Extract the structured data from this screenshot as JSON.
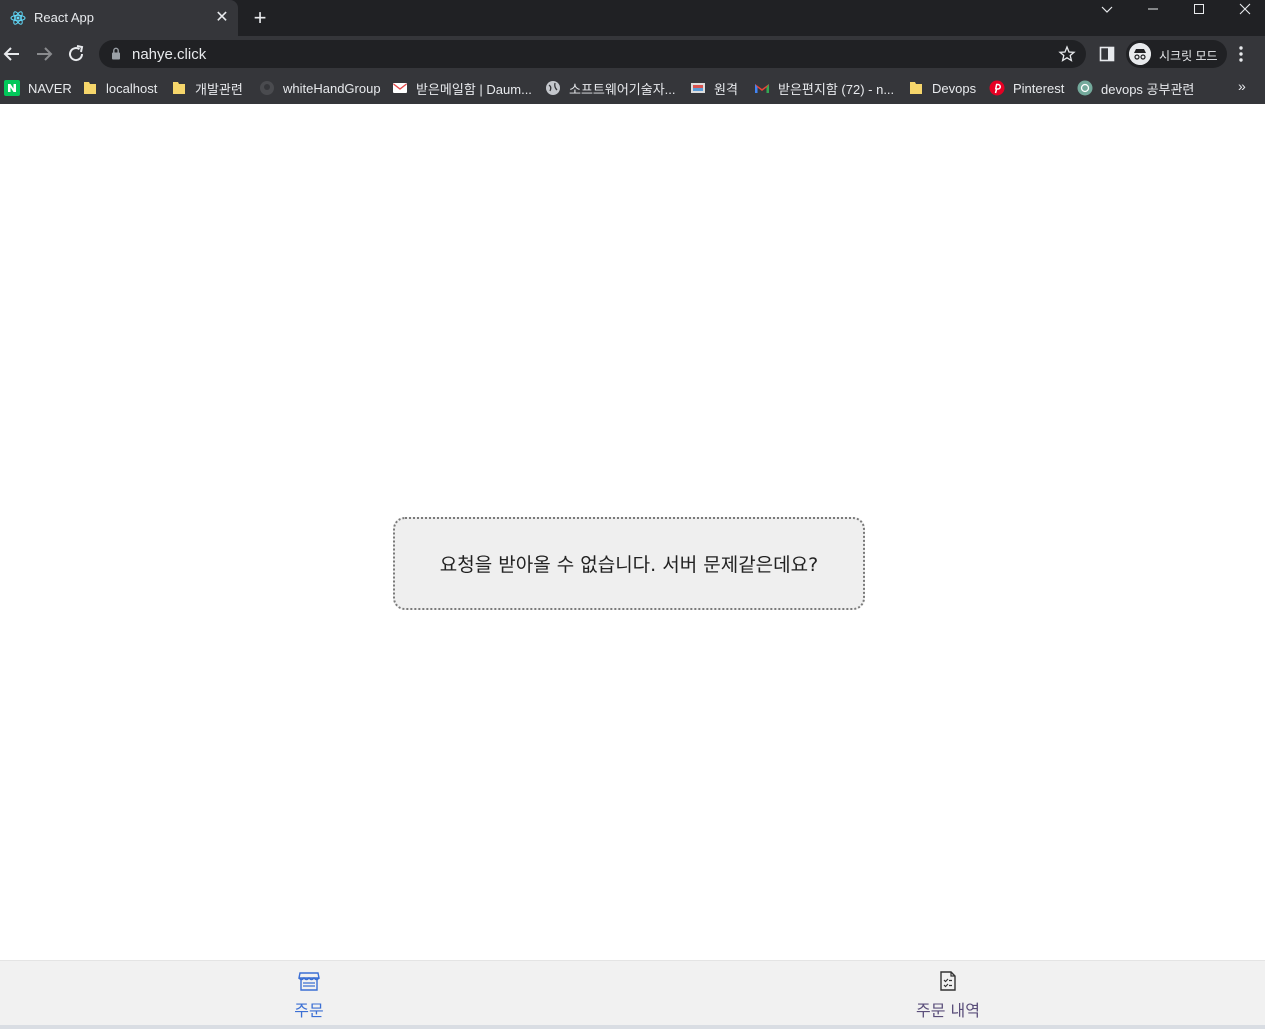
{
  "browser": {
    "tab": {
      "title": "React App",
      "favicon": "react-icon"
    },
    "url": "nahye.click",
    "incognito_label": "시크릿 모드",
    "bookmarks": [
      {
        "label": "NAVER",
        "icon": "naver-icon"
      },
      {
        "label": "localhost",
        "icon": "folder-icon"
      },
      {
        "label": "개발관련",
        "icon": "folder-icon"
      },
      {
        "label": "whiteHandGroup",
        "icon": "github-icon"
      },
      {
        "label": "받은메일함 | Daum...",
        "icon": "mail-icon"
      },
      {
        "label": "소프트웨어기술자...",
        "icon": "globe-icon"
      },
      {
        "label": "원격",
        "icon": "remote-icon"
      },
      {
        "label": "받은편지함 (72) - n...",
        "icon": "gmail-icon"
      },
      {
        "label": "Devops",
        "icon": "folder-icon"
      },
      {
        "label": "Pinterest",
        "icon": "pinterest-icon"
      },
      {
        "label": "devops 공부관련",
        "icon": "openai-icon"
      }
    ]
  },
  "page": {
    "error_message": "요청을 받아올 수 없습니다. 서버 문제같은데요?"
  },
  "bottom_nav": {
    "items": [
      {
        "label": "주문",
        "icon": "store-icon",
        "active": true
      },
      {
        "label": "주문 내역",
        "icon": "receipt-icon",
        "active": false
      }
    ],
    "active_color": "#3b6fd4",
    "inactive_color": "#5a4e7a"
  }
}
